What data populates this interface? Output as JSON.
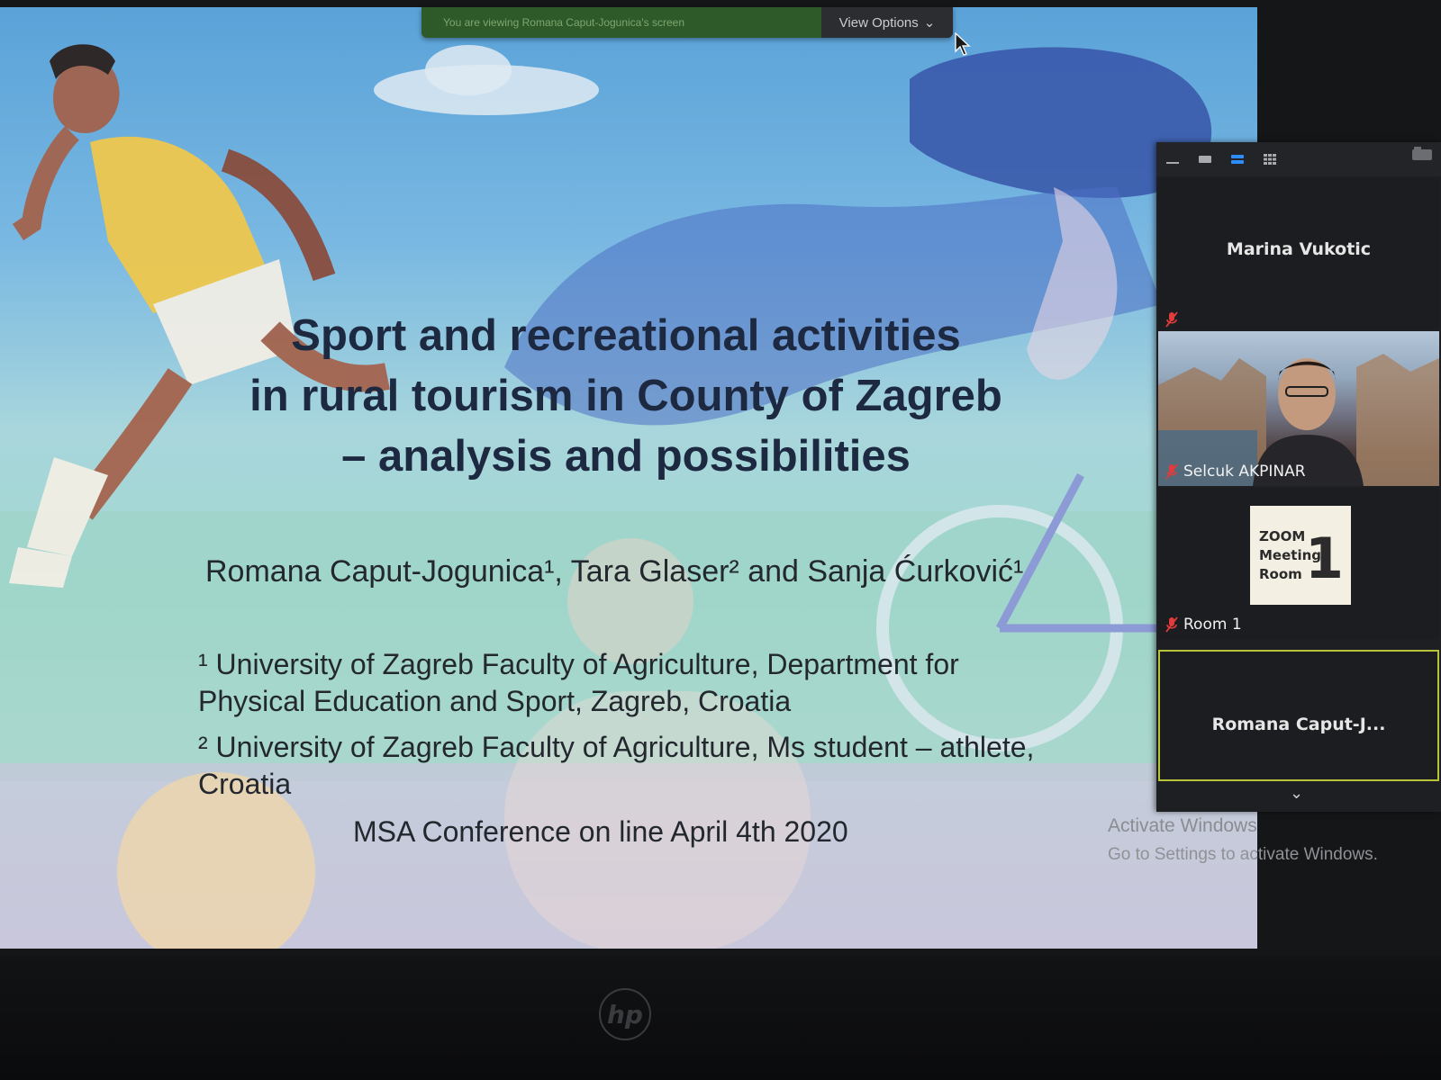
{
  "share_bar": {
    "message": "You are viewing Romana Caput-Jogunica's screen",
    "view_options_label": "View Options",
    "chevron_icon": "chevron-down-icon"
  },
  "slide": {
    "title_lines": [
      "Sport and recreational activities",
      "in rural tourism in County of Zagreb",
      "– analysis and possibilities"
    ],
    "authors": "Romana Caput-Jogunica¹, Tara Glaser² and Sanja Ćurković¹",
    "affiliation_1": "¹ University of Zagreb Faculty of Agriculture, Department for Physical Education and Sport, Zagreb, Croatia",
    "affiliation_2": "² University of Zagreb Faculty of Agriculture, Ms student – athlete, Croatia",
    "conference": "MSA Conference on line April 4th 2020"
  },
  "participants_panel": {
    "toolbar_icons": [
      "minimize-icon",
      "thumbnail-view-icon",
      "speaker-view-icon",
      "gallery-view-icon"
    ],
    "tiles": [
      {
        "name": "Marina Vukotic",
        "muted": true
      },
      {
        "name": "Selcuk AKPINAR",
        "muted": true
      },
      {
        "name": "Room 1",
        "muted": true,
        "card_text": "ZOOM\nMeeting\nRoom",
        "card_number": "1"
      },
      {
        "name": "Romana  Caput-J...",
        "muted": false
      }
    ],
    "scroll_icon": "chevron-down-icon"
  },
  "watermark": {
    "line1": "Activate Windows",
    "line2": "Go to Settings to activate Windows."
  },
  "colors": {
    "slide_title": "#1d2940",
    "share_bar_green": "#2e5a2a",
    "active_speaker_border": "#b7c43a"
  }
}
